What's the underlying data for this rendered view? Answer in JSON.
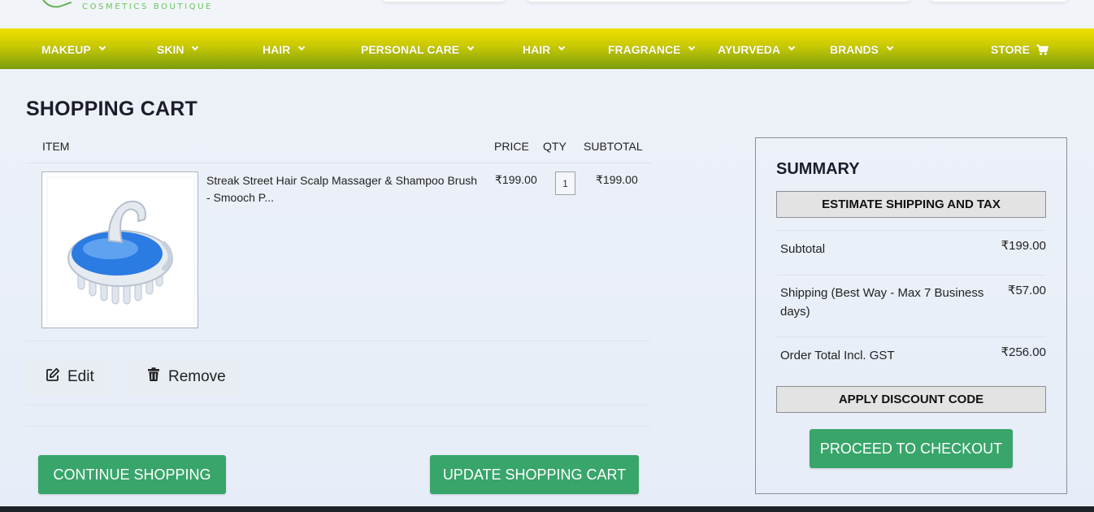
{
  "header": {
    "logo_tagline": "COSMETICS BOUTIQUE"
  },
  "nav": {
    "items": [
      {
        "label": "MAKEUP"
      },
      {
        "label": "SKIN"
      },
      {
        "label": "HAIR"
      },
      {
        "label": "PERSONAL CARE"
      },
      {
        "label": "HAIR"
      },
      {
        "label": "FRAGRANCE"
      },
      {
        "label": "AYURVEDA"
      },
      {
        "label": "BRANDS"
      }
    ],
    "store_label": "STORE",
    "store_icon": "shopping-cart-icon"
  },
  "cart": {
    "title": "SHOPPING CART",
    "columns": {
      "item": "ITEM",
      "price": "PRICE",
      "qty": "QTY",
      "subtotal": "SUBTOTAL"
    },
    "items": [
      {
        "name": "Streak Street Hair Scalp Massager & Shampoo Brush - Smooch P...",
        "price": "₹199.00",
        "qty": "1",
        "subtotal": "₹199.00"
      }
    ],
    "edit_label": "Edit",
    "remove_label": "Remove",
    "continue_label": "CONTINUE SHOPPING",
    "update_label": "UPDATE SHOPPING CART"
  },
  "summary": {
    "title": "SUMMARY",
    "estimate_label": "ESTIMATE SHIPPING AND TAX",
    "rows": [
      {
        "label": "Subtotal",
        "value": "₹199.00"
      },
      {
        "label": "Shipping (Best Way - Max 7 Business days)",
        "value": "₹57.00"
      },
      {
        "label": "Order Total Incl. GST",
        "value": "₹256.00"
      }
    ],
    "discount_label": "APPLY DISCOUNT CODE",
    "checkout_label": "PROCEED TO CHECKOUT"
  },
  "colors": {
    "nav_gradient_top": "#f0e000",
    "nav_gradient_bottom": "#7b9d10",
    "primary_green": "#38a56a",
    "logo_green": "#6cc45c"
  }
}
